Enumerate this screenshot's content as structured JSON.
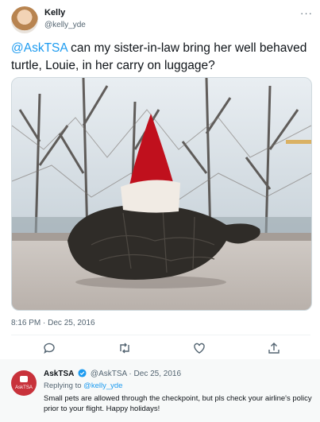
{
  "tweet": {
    "author_name": "Kelly",
    "author_handle": "@kelly_yde",
    "mention": "@AskTSA",
    "text": " can my sister-in-law bring her well behaved turtle, Louie, in her carry on luggage?",
    "timestamp": "8:16 PM · Dec 25, 2016",
    "more_label": "···"
  },
  "reply": {
    "author_name": "AskTSA",
    "author_handle": "@AskTSA",
    "separator": "·",
    "date": "Dec 25, 2016",
    "replying_prefix": "Replying to ",
    "replying_handle": "@kelly_yde",
    "text": "Small pets are allowed through the checkpoint, but pls check your airline's policy prior to your flight. Happy holidays!",
    "avatar_text": "AskTSA"
  },
  "icons": {
    "reply": "comment-icon",
    "retweet": "retweet-icon",
    "like": "heart-icon",
    "share": "share-icon",
    "verified": "verified-badge-icon"
  },
  "colors": {
    "accent": "#1d9bf0",
    "secondary_text": "#536471",
    "tsa_red": "#c8323b"
  }
}
